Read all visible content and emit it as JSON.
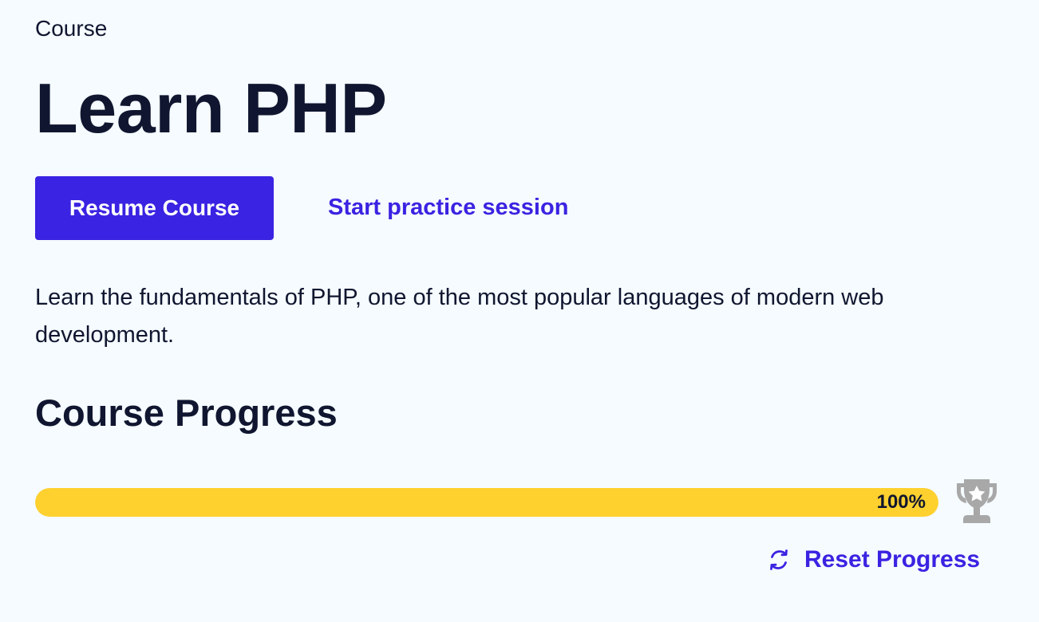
{
  "course": {
    "eyebrow": "Course",
    "title": "Learn PHP",
    "resume_button_label": "Resume Course",
    "practice_link_label": "Start practice session",
    "description": "Learn the fundamentals of PHP, one of the most popular languages of modern web development."
  },
  "progress": {
    "section_title": "Course Progress",
    "percent_value": 100,
    "percent_label": "100%",
    "trophy_icon": "trophy-icon",
    "reset_icon": "refresh-icon",
    "reset_label": "Reset Progress"
  },
  "colors": {
    "background": "#f5fbff",
    "primary": "#3a23e2",
    "progress_fill": "#ffd12f",
    "trophy": "#a8a8a8",
    "text": "#10162f"
  }
}
